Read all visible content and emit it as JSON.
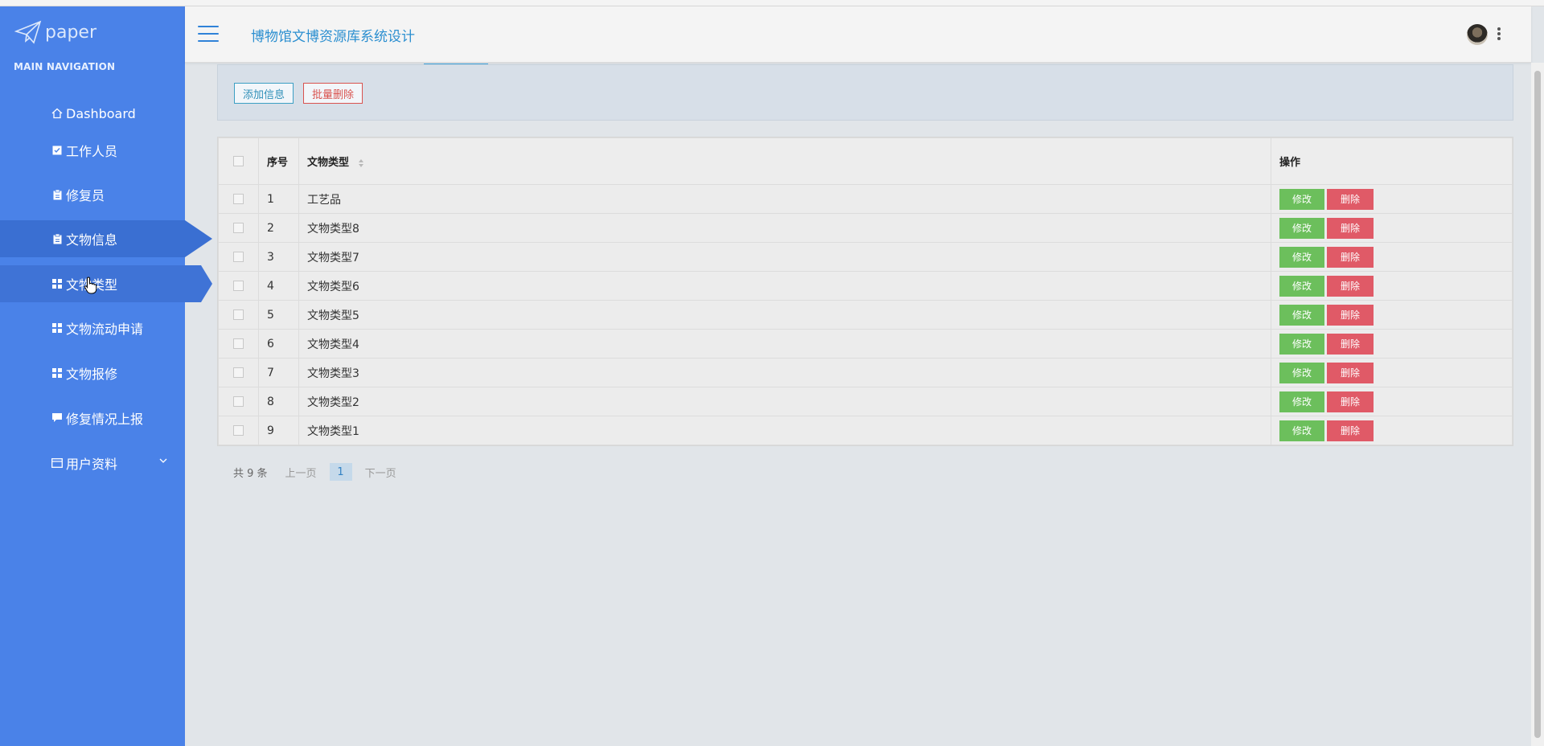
{
  "app": {
    "logo_text": "paper",
    "title": "博物馆文博资源库系统设计"
  },
  "sidebar": {
    "section_header": "MAIN NAVIGATION",
    "items": [
      {
        "label": "Dashboard",
        "icon": "home-icon"
      },
      {
        "label": "工作人员",
        "icon": "check-square-icon"
      },
      {
        "label": "修复员",
        "icon": "clipboard-icon"
      },
      {
        "label": "文物信息",
        "icon": "clipboard-icon"
      },
      {
        "label": "文物类型",
        "icon": "grid-icon"
      },
      {
        "label": "文物流动申请",
        "icon": "grid-icon"
      },
      {
        "label": "文物报修",
        "icon": "grid-icon"
      },
      {
        "label": "修复情况上报",
        "icon": "comment-icon"
      },
      {
        "label": "用户资料",
        "icon": "id-card-icon"
      }
    ]
  },
  "toolbar": {
    "add_label": "添加信息",
    "batch_delete_label": "批量删除"
  },
  "table": {
    "columns": {
      "index": "序号",
      "type": "文物类型",
      "ops": "操作"
    },
    "rows": [
      {
        "index": "1",
        "type": "工艺品"
      },
      {
        "index": "2",
        "type": "文物类型8"
      },
      {
        "index": "3",
        "type": "文物类型7"
      },
      {
        "index": "4",
        "type": "文物类型6"
      },
      {
        "index": "5",
        "type": "文物类型5"
      },
      {
        "index": "6",
        "type": "文物类型4"
      },
      {
        "index": "7",
        "type": "文物类型3"
      },
      {
        "index": "8",
        "type": "文物类型2"
      },
      {
        "index": "9",
        "type": "文物类型1"
      }
    ],
    "edit_label": "修改",
    "delete_label": "删除"
  },
  "pagination": {
    "total": "共 9 条",
    "prev": "上一页",
    "current": "1",
    "next": "下一页"
  },
  "colors": {
    "sidebar_bg": "#4a82e8",
    "accent": "#2c8fd0",
    "edit_btn": "#6cbf5c",
    "delete_btn": "#e05a67"
  }
}
